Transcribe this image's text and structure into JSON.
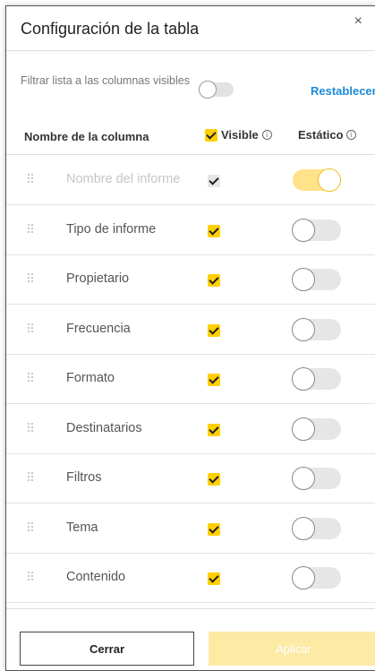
{
  "dialog": {
    "title": "Configuración de la tabla",
    "close_glyph": "×"
  },
  "filter": {
    "label": "Filtrar lista a las columnas visibles",
    "enabled": false,
    "reset_label": "Restablecer"
  },
  "columns_header": {
    "name": "Nombre de la columna",
    "visible": "Visible",
    "static": "Estático",
    "info_glyph": "i"
  },
  "rows": [
    {
      "name": "Nombre del informe",
      "visible": true,
      "static": true,
      "locked": true
    },
    {
      "name": "Tipo de informe",
      "visible": true,
      "static": false,
      "locked": false
    },
    {
      "name": "Propietario",
      "visible": true,
      "static": false,
      "locked": false
    },
    {
      "name": "Frecuencia",
      "visible": true,
      "static": false,
      "locked": false
    },
    {
      "name": "Formato",
      "visible": true,
      "static": false,
      "locked": false
    },
    {
      "name": "Destinatarios",
      "visible": true,
      "static": false,
      "locked": false
    },
    {
      "name": "Filtros",
      "visible": true,
      "static": false,
      "locked": false
    },
    {
      "name": "Tema",
      "visible": true,
      "static": false,
      "locked": false
    },
    {
      "name": "Contenido",
      "visible": true,
      "static": false,
      "locked": false
    }
  ],
  "footer": {
    "close_label": "Cerrar",
    "apply_label": "Aplicar"
  },
  "colors": {
    "accent": "#ffcf00",
    "link": "#1c8ad6",
    "toggle_on": "#ffe38a",
    "apply_disabled": "#fdeaa5"
  },
  "icons": [
    "close-icon",
    "info-icon",
    "drag-handle-icon",
    "checkmark-icon"
  ]
}
